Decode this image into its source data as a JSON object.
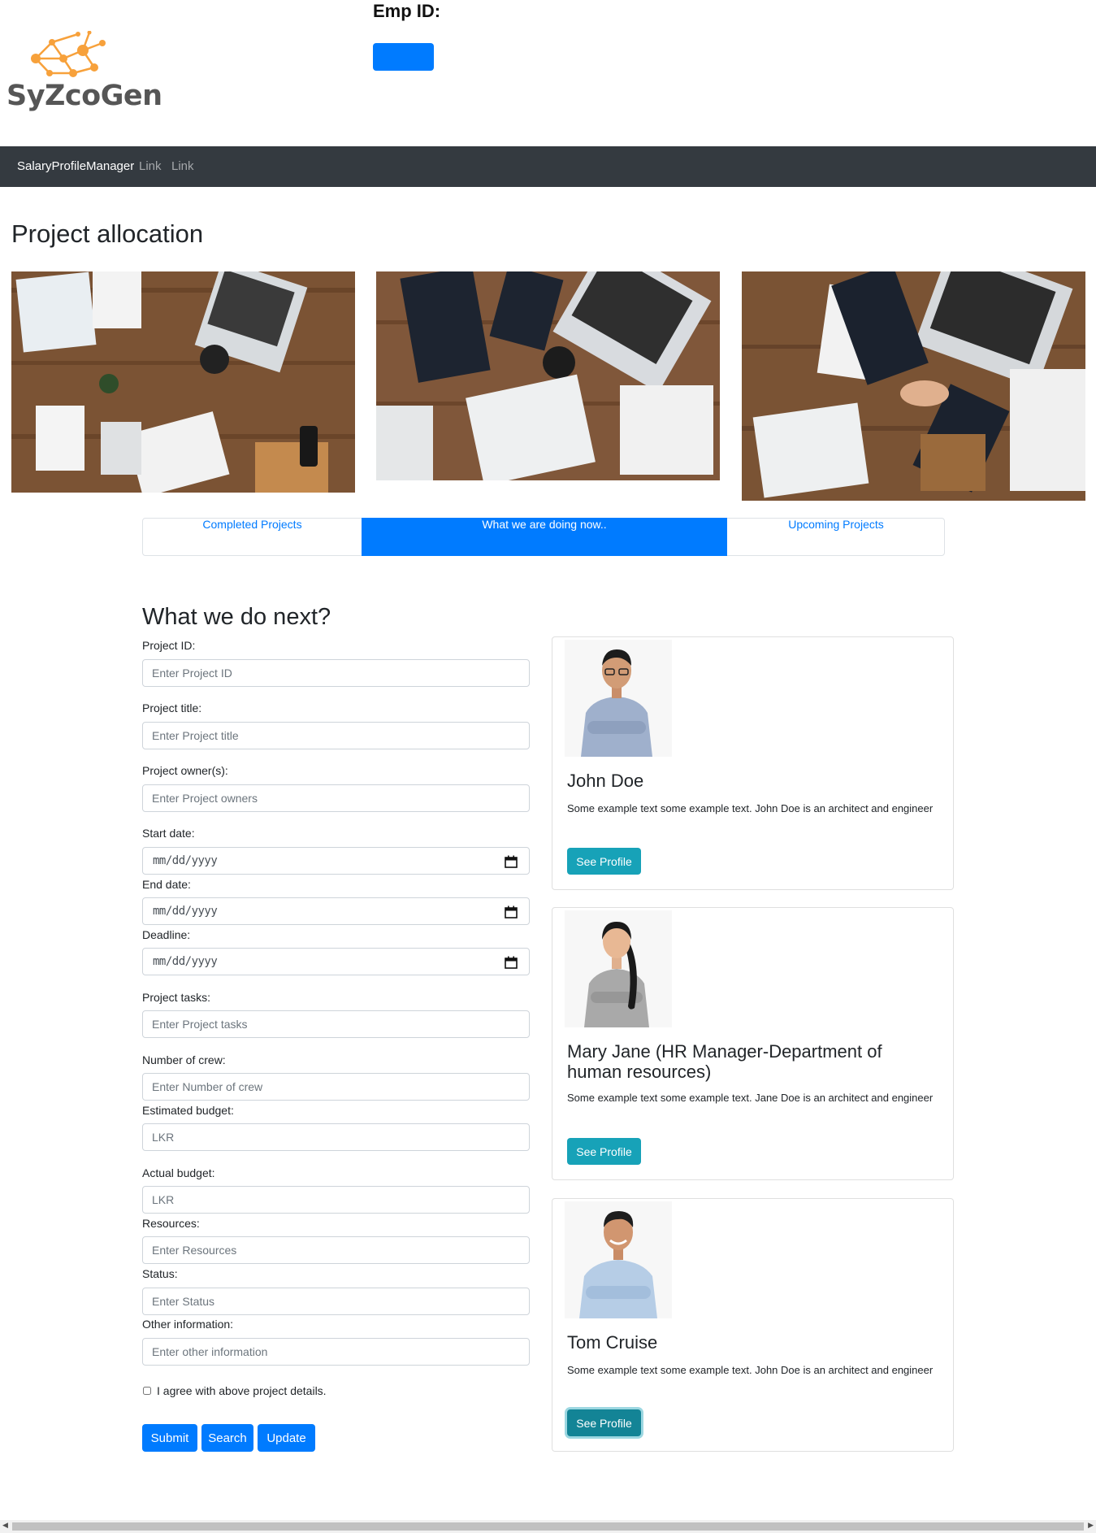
{
  "header": {
    "logo_text": "SyZcoGen",
    "emp_id_label": "Emp ID:",
    "emp_button_label": ""
  },
  "navbar": {
    "brand": "SalaryProfileManager",
    "links": [
      "Link",
      "Link"
    ]
  },
  "page_title": "Project allocation",
  "tabs": [
    {
      "label": "Completed Projects",
      "active": false
    },
    {
      "label": "What we are doing now..",
      "active": true
    },
    {
      "label": "Upcoming Projects",
      "active": false
    }
  ],
  "form": {
    "title": "What we do next?",
    "fields": {
      "project_id": {
        "label": "Project ID:",
        "placeholder": "Enter Project ID"
      },
      "project_title": {
        "label": "Project title:",
        "placeholder": "Enter Project title"
      },
      "project_owners": {
        "label": "Project owner(s):",
        "placeholder": "Enter Project owners"
      },
      "start_date": {
        "label": "Start date:",
        "value": "mm/dd/yyyy"
      },
      "end_date": {
        "label": "End date:",
        "value": "mm/dd/yyyy"
      },
      "deadline": {
        "label": "Deadline:",
        "value": "mm/dd/yyyy"
      },
      "project_tasks": {
        "label": "Project tasks:",
        "placeholder": "Enter Project tasks"
      },
      "crew": {
        "label": "Number of crew:",
        "placeholder": "Enter Number of crew"
      },
      "estimated_budget": {
        "label": "Estimated budget:",
        "placeholder": "LKR"
      },
      "actual_budget": {
        "label": "Actual budget:",
        "placeholder": "LKR"
      },
      "resources": {
        "label": "Resources:",
        "placeholder": "Enter Resources"
      },
      "status": {
        "label": "Status:",
        "placeholder": "Enter Status"
      },
      "other_info": {
        "label": "Other information:",
        "placeholder": "Enter other information"
      }
    },
    "agree_label": "I agree with above project details.",
    "buttons": {
      "submit": "Submit",
      "search": "Search",
      "update": "Update"
    }
  },
  "cards": [
    {
      "name": "John Doe",
      "text": "Some example text some example text. John Doe is an architect and engineer",
      "button": "See Profile"
    },
    {
      "name": "Mary Jane (HR Manager-Department of human resources)",
      "text": "Some example text some example text. Jane Doe is an architect and engineer",
      "button": "See Profile"
    },
    {
      "name": "Tom Cruise",
      "text": "Some example text some example text. John Doe is an architect and engineer",
      "button": "See Profile"
    }
  ],
  "colors": {
    "primary": "#007bff",
    "info": "#17a2b8",
    "navbar": "#343a40",
    "logo_orange": "#f7a13b"
  },
  "icons": [
    "calendar-icon",
    "scroll-left-arrow",
    "scroll-right-arrow"
  ]
}
